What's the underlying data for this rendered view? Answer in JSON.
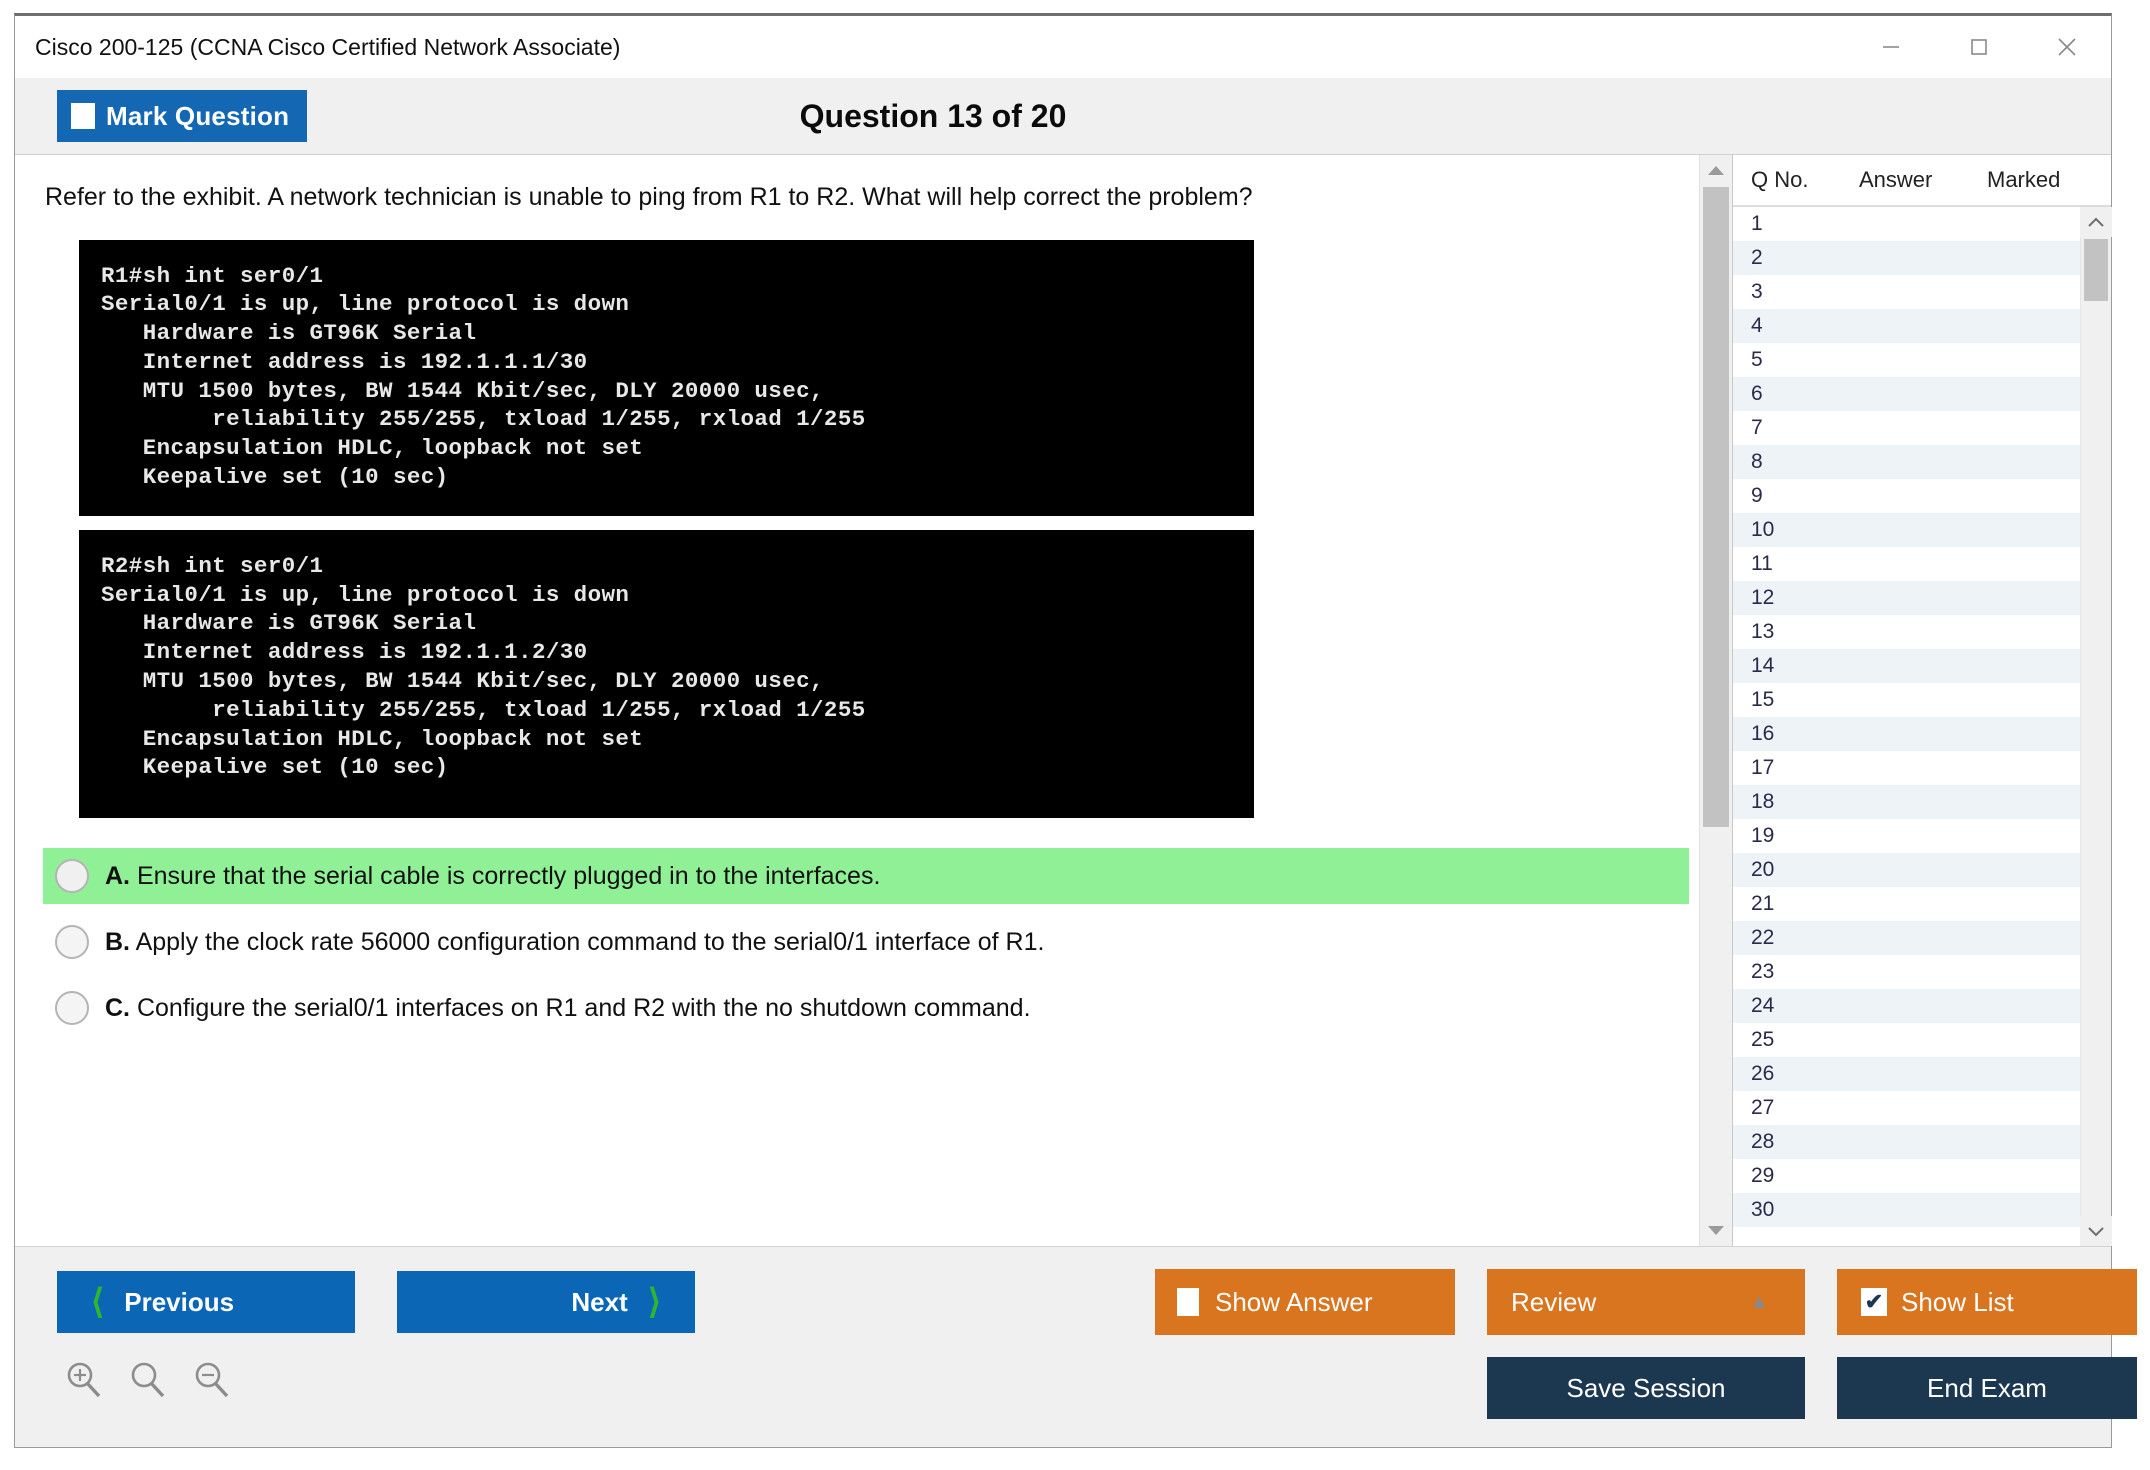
{
  "window": {
    "title": "Cisco 200-125 (CCNA Cisco Certified Network Associate)",
    "controls": {
      "minimize": "minimize-icon",
      "maximize": "maximize-icon",
      "close": "close-icon"
    }
  },
  "header": {
    "mark_question_label": "Mark Question",
    "question_counter": "Question 13 of 20"
  },
  "question": {
    "text": "Refer to the exhibit. A network technician is unable to ping from R1 to R2. What will help correct the problem?",
    "exhibits": [
      {
        "name": "r1-terminal-output",
        "lines": "R1#sh int ser0/1\nSerial0/1 is up, line protocol is down\n   Hardware is GT96K Serial\n   Internet address is 192.1.1.1/30\n   MTU 1500 bytes, BW 1544 Kbit/sec, DLY 20000 usec,\n        reliability 255/255, txload 1/255, rxload 1/255\n   Encapsulation HDLC, loopback not set\n   Keepalive set (10 sec)"
      },
      {
        "name": "r2-terminal-output",
        "lines": "R2#sh int ser0/1\nSerial0/1 is up, line protocol is down\n   Hardware is GT96K Serial\n   Internet address is 192.1.1.2/30\n   MTU 1500 bytes, BW 1544 Kbit/sec, DLY 20000 usec,\n        reliability 255/255, txload 1/255, rxload 1/255\n   Encapsulation HDLC, loopback not set\n   Keepalive set (10 sec)"
      }
    ],
    "options": [
      {
        "letter": "A.",
        "text": "Ensure that the serial cable is correctly plugged in to the interfaces.",
        "highlighted": true,
        "selected": false
      },
      {
        "letter": "B.",
        "text": "Apply the clock rate 56000 configuration command to the serial0/1 interface of R1.",
        "highlighted": false,
        "selected": false
      },
      {
        "letter": "C.",
        "text": "Configure the serial0/1 interfaces on R1 and R2 with the no shutdown command.",
        "highlighted": false,
        "selected": false
      }
    ]
  },
  "list_panel": {
    "columns": [
      "Q No.",
      "Answer",
      "Marked"
    ],
    "rows": [
      {
        "qno": "1",
        "answer": "",
        "marked": ""
      },
      {
        "qno": "2",
        "answer": "",
        "marked": ""
      },
      {
        "qno": "3",
        "answer": "",
        "marked": ""
      },
      {
        "qno": "4",
        "answer": "",
        "marked": ""
      },
      {
        "qno": "5",
        "answer": "",
        "marked": ""
      },
      {
        "qno": "6",
        "answer": "",
        "marked": ""
      },
      {
        "qno": "7",
        "answer": "",
        "marked": ""
      },
      {
        "qno": "8",
        "answer": "",
        "marked": ""
      },
      {
        "qno": "9",
        "answer": "",
        "marked": ""
      },
      {
        "qno": "10",
        "answer": "",
        "marked": ""
      },
      {
        "qno": "11",
        "answer": "",
        "marked": ""
      },
      {
        "qno": "12",
        "answer": "",
        "marked": ""
      },
      {
        "qno": "13",
        "answer": "",
        "marked": ""
      },
      {
        "qno": "14",
        "answer": "",
        "marked": ""
      },
      {
        "qno": "15",
        "answer": "",
        "marked": ""
      },
      {
        "qno": "16",
        "answer": "",
        "marked": ""
      },
      {
        "qno": "17",
        "answer": "",
        "marked": ""
      },
      {
        "qno": "18",
        "answer": "",
        "marked": ""
      },
      {
        "qno": "19",
        "answer": "",
        "marked": ""
      },
      {
        "qno": "20",
        "answer": "",
        "marked": ""
      },
      {
        "qno": "21",
        "answer": "",
        "marked": ""
      },
      {
        "qno": "22",
        "answer": "",
        "marked": ""
      },
      {
        "qno": "23",
        "answer": "",
        "marked": ""
      },
      {
        "qno": "24",
        "answer": "",
        "marked": ""
      },
      {
        "qno": "25",
        "answer": "",
        "marked": ""
      },
      {
        "qno": "26",
        "answer": "",
        "marked": ""
      },
      {
        "qno": "27",
        "answer": "",
        "marked": ""
      },
      {
        "qno": "28",
        "answer": "",
        "marked": ""
      },
      {
        "qno": "29",
        "answer": "",
        "marked": ""
      },
      {
        "qno": "30",
        "answer": "",
        "marked": ""
      }
    ]
  },
  "toolbar": {
    "previous_label": "Previous",
    "next_label": "Next",
    "show_answer_label": "Show Answer",
    "show_answer_checked": false,
    "review_label": "Review",
    "show_list_label": "Show List",
    "show_list_checked": true,
    "show_list_check_glyph": "✔",
    "save_session_label": "Save Session",
    "end_exam_label": "End Exam",
    "zoom_in_icon": "zoom-in-icon",
    "zoom_reset_icon": "zoom-icon",
    "zoom_out_icon": "zoom-out-icon"
  },
  "colors": {
    "accent_blue": "#0b67b5",
    "accent_orange": "#d9741f",
    "accent_navy": "#1b3850",
    "highlight_green": "#90f096",
    "chevron_green": "#2fb62f",
    "header_gray": "#f0f0f0"
  }
}
